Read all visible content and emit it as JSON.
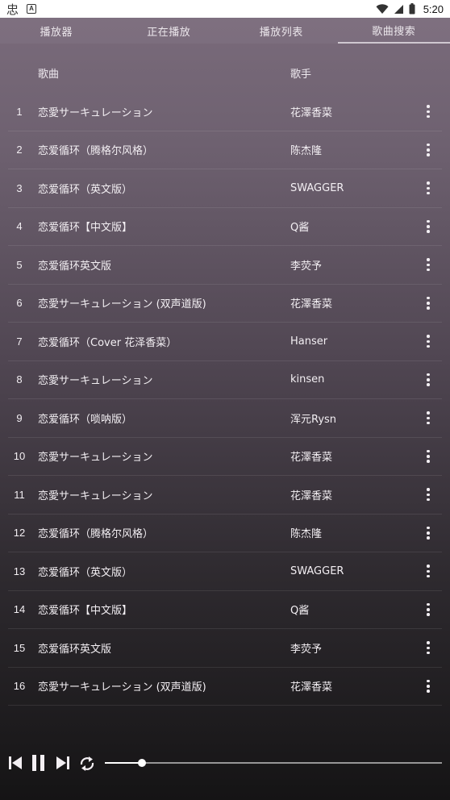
{
  "status_bar": {
    "left_glyph": "忠",
    "badge": "A",
    "time": "5:20",
    "icons": [
      "wifi-icon",
      "signal-icon",
      "battery-icon"
    ]
  },
  "tabs": [
    {
      "label": "播放器",
      "active": false
    },
    {
      "label": "正在播放",
      "active": false
    },
    {
      "label": "播放列表",
      "active": false
    },
    {
      "label": "歌曲搜索",
      "active": true
    }
  ],
  "header": {
    "song": "歌曲",
    "artist": "歌手"
  },
  "songs": [
    {
      "num": "1",
      "title": "恋愛サーキュレーション",
      "artist": "花澤香菜"
    },
    {
      "num": "2",
      "title": "恋爱循环（腾格尔风格）",
      "artist": "陈杰隆"
    },
    {
      "num": "3",
      "title": "恋爱循环（英文版）",
      "artist": "SWAGGER"
    },
    {
      "num": "4",
      "title": "恋爱循环【中文版】",
      "artist": "Q酱"
    },
    {
      "num": "5",
      "title": "恋爱循环英文版",
      "artist": "李荧予"
    },
    {
      "num": "6",
      "title": "恋愛サーキュレーション (双声道版)",
      "artist": "花澤香菜"
    },
    {
      "num": "7",
      "title": "恋爱循环（Cover 花泽香菜）",
      "artist": "Hanser"
    },
    {
      "num": "8",
      "title": "恋愛サーキュレーション",
      "artist": "kinsen"
    },
    {
      "num": "9",
      "title": "恋爱循环（唢呐版）",
      "artist": "浑元Rysn"
    },
    {
      "num": "10",
      "title": "恋愛サーキュレーション",
      "artist": "花澤香菜"
    },
    {
      "num": "11",
      "title": "恋愛サーキュレーション",
      "artist": "花澤香菜"
    },
    {
      "num": "12",
      "title": "恋爱循环（腾格尔风格）",
      "artist": "陈杰隆"
    },
    {
      "num": "13",
      "title": "恋爱循环（英文版）",
      "artist": "SWAGGER"
    },
    {
      "num": "14",
      "title": "恋爱循环【中文版】",
      "artist": "Q酱"
    },
    {
      "num": "15",
      "title": "恋爱循环英文版",
      "artist": "李荧予"
    },
    {
      "num": "16",
      "title": "恋愛サーキュレーション (双声道版)",
      "artist": "花澤香菜"
    }
  ],
  "player": {
    "controls": [
      "skip-previous-icon",
      "pause-icon",
      "skip-next-icon",
      "repeat-icon"
    ],
    "progress_fraction": 0.11
  },
  "colors": {
    "bg_top": "#7b6c7c",
    "bg_bottom": "#151415",
    "text": "#f3eff3"
  }
}
